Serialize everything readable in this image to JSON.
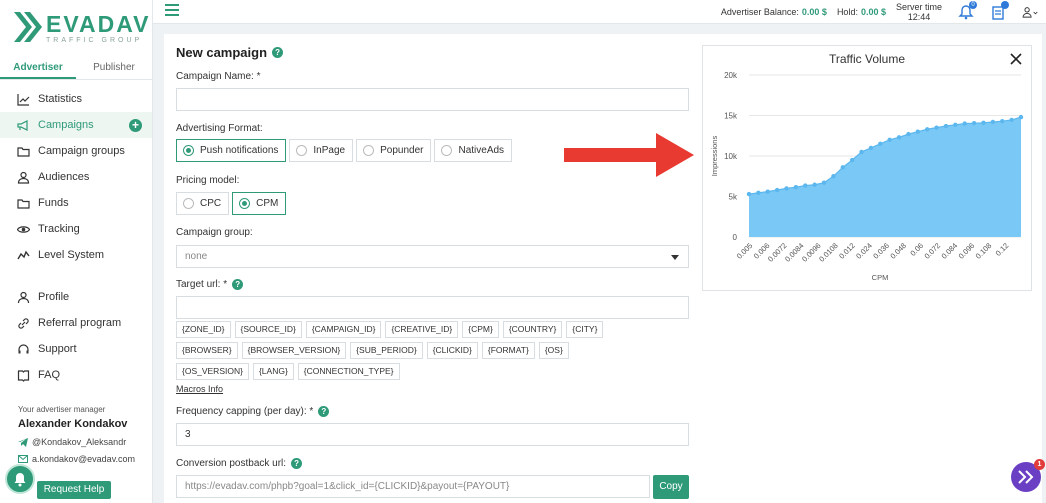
{
  "brand": {
    "name": "EVADAV",
    "sub": "TRAFFIC GROUP"
  },
  "role_tabs": [
    {
      "label": "Advertiser",
      "active": true
    },
    {
      "label": "Publisher",
      "active": false
    }
  ],
  "nav": [
    {
      "label": "Statistics",
      "icon": "chart-line-icon"
    },
    {
      "label": "Campaigns",
      "icon": "megaphone-icon",
      "active": true
    },
    {
      "label": "Campaign groups",
      "icon": "folder-icon"
    },
    {
      "label": "Audiences",
      "icon": "users-icon"
    },
    {
      "label": "Funds",
      "icon": "folder-icon"
    },
    {
      "label": "Tracking",
      "icon": "eye-icon"
    },
    {
      "label": "Level System",
      "icon": "level-icon"
    }
  ],
  "nav2": [
    {
      "label": "Profile",
      "icon": "user-icon"
    },
    {
      "label": "Referral program",
      "icon": "link-icon"
    },
    {
      "label": "Support",
      "icon": "headset-icon"
    },
    {
      "label": "FAQ",
      "icon": "book-icon"
    }
  ],
  "manager": {
    "caption": "Your advertiser manager",
    "name": "Alexander Kondakov",
    "telegram": "@Kondakov_Aleksandr",
    "email": "a.kondakov@evadav.com",
    "help": "Request Help"
  },
  "topbar": {
    "balance_label": "Advertiser Balance:",
    "balance_value": "0.00 $",
    "hold_label": "Hold:",
    "hold_value": "0.00 $",
    "server_label": "Server time",
    "server_time": "12:44",
    "bell_badge": "0"
  },
  "form": {
    "title": "New campaign",
    "campaign_name_label": "Campaign Name: *",
    "campaign_name_value": "",
    "ad_format_label": "Advertising Format:",
    "ad_formats": [
      {
        "label": "Push notifications",
        "selected": true
      },
      {
        "label": "InPage",
        "selected": false
      },
      {
        "label": "Popunder",
        "selected": false
      },
      {
        "label": "NativeAds",
        "selected": false
      }
    ],
    "pricing_label": "Pricing model:",
    "pricing": [
      {
        "label": "CPC",
        "selected": false
      },
      {
        "label": "CPM",
        "selected": true
      }
    ],
    "group_label": "Campaign group:",
    "group_value": "none",
    "target_label": "Target url: *",
    "target_value": "",
    "macros": [
      "{ZONE_ID}",
      "{SOURCE_ID}",
      "{CAMPAIGN_ID}",
      "{CREATIVE_ID}",
      "{CPM}",
      "{COUNTRY}",
      "{CITY}",
      "{BROWSER}",
      "{BROWSER_VERSION}",
      "{SUB_PERIOD}",
      "{CLICKID}",
      "{FORMAT}",
      "{OS}",
      "{OS_VERSION}",
      "{LANG}",
      "{CONNECTION_TYPE}"
    ],
    "macros_link": "Macros Info",
    "freq_label": "Frequency capping (per day): *",
    "freq_value": "3",
    "postback_label": "Conversion postback url:",
    "postback_value": "https://evadav.com/phpb?goal=1&click_id={CLICKID}&payout={PAYOUT}",
    "copy": "Copy"
  },
  "chart_data": {
    "type": "area",
    "title": "Traffic Volume",
    "xlabel": "CPM",
    "ylabel": "Impressions",
    "yticks": [
      "0",
      "5k",
      "10k",
      "15k",
      "20k"
    ],
    "ylim": [
      0,
      20000
    ],
    "xticks": [
      "0.005",
      "0.006",
      "0.0072",
      "0.0084",
      "0.0096",
      "0.0108",
      "0.012",
      "0.024",
      "0.036",
      "0.048",
      "0.06",
      "0.072",
      "0.084",
      "0.096",
      "0.108",
      "0.12"
    ],
    "values": [
      5300,
      5450,
      5600,
      5800,
      6000,
      6150,
      6350,
      6450,
      6700,
      7500,
      8600,
      9500,
      10500,
      11000,
      11500,
      12000,
      12300,
      12700,
      13000,
      13300,
      13500,
      13700,
      13850,
      14000,
      14050,
      14100,
      14200,
      14300,
      14450,
      14800
    ],
    "color": "#7ac8f5"
  },
  "chat_badge": "1"
}
